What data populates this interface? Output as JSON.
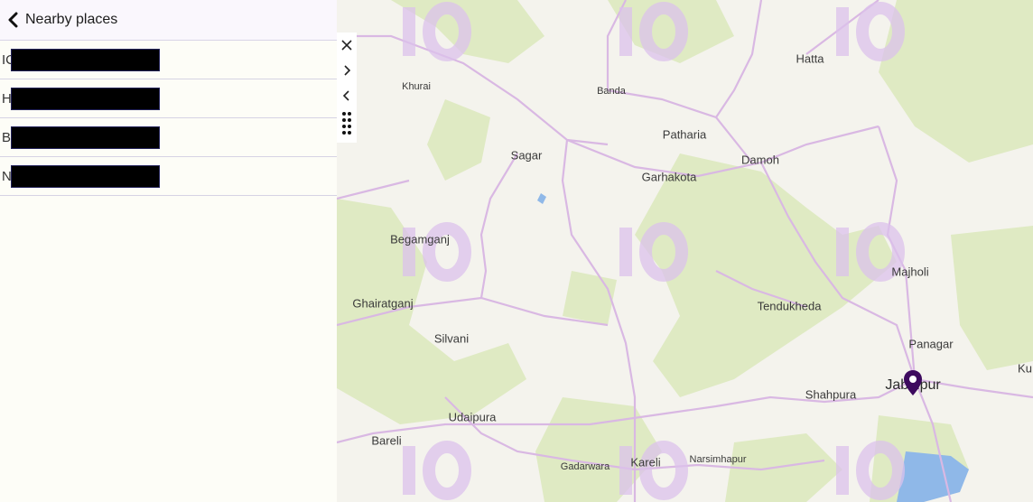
{
  "panel": {
    "title": "Nearby places",
    "back_icon": "chevron-left-icon",
    "items": [
      {
        "initial": "IC"
      },
      {
        "initial": "H"
      },
      {
        "initial": "B"
      },
      {
        "initial": "N"
      }
    ]
  },
  "toolbar": {
    "icons": [
      "close-icon",
      "chevron-right-icon",
      "chevron-left-icon",
      "drag-handle-icon"
    ]
  },
  "map": {
    "places": [
      {
        "name": "Khurai",
        "size": "small"
      },
      {
        "name": "Banda",
        "size": "small"
      },
      {
        "name": "Hatta",
        "size": "normal"
      },
      {
        "name": "Sagar",
        "size": "normal"
      },
      {
        "name": "Patharia",
        "size": "normal"
      },
      {
        "name": "Damoh",
        "size": "normal"
      },
      {
        "name": "Garhakota",
        "size": "normal"
      },
      {
        "name": "Begamganj",
        "size": "normal"
      },
      {
        "name": "Majholi",
        "size": "normal"
      },
      {
        "name": "Ghairatganj",
        "size": "normal"
      },
      {
        "name": "Tendukheda",
        "size": "normal"
      },
      {
        "name": "Silvani",
        "size": "normal"
      },
      {
        "name": "Panagar",
        "size": "normal"
      },
      {
        "name": "Ku",
        "size": "normal"
      },
      {
        "name": "Shahpura",
        "size": "normal"
      },
      {
        "name": "Jabalpur",
        "size": "big"
      },
      {
        "name": "Udaipura",
        "size": "normal"
      },
      {
        "name": "Bareli",
        "size": "normal"
      },
      {
        "name": "Gadarwara",
        "size": "small"
      },
      {
        "name": "Kareli",
        "size": "normal"
      },
      {
        "name": "Narsimhapur",
        "size": "small"
      }
    ],
    "watermark_text": "IO",
    "pin_icon": "location-pin-icon",
    "colors": {
      "land": "#f4f3ed",
      "forest": "#dfeac3",
      "road": "#d9b8e3",
      "water": "#8fb8e8",
      "watermark": "#dcc2ec",
      "pin": "#3d0a5e"
    }
  }
}
